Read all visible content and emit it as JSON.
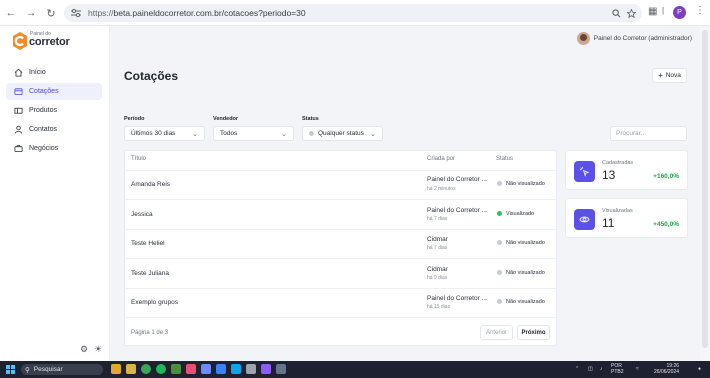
{
  "browser": {
    "url_protocol": "https://",
    "url_rest": "beta.paineldocorretor.com.br/cotacoes?periodo=30",
    "profile_letter": "P"
  },
  "logo": {
    "small": "Painel do",
    "big": "corretor"
  },
  "sidebar": {
    "items": [
      {
        "label": "Início",
        "icon": "home-icon"
      },
      {
        "label": "Cotações",
        "icon": "document-icon",
        "active": true
      },
      {
        "label": "Produtos",
        "icon": "box-icon"
      },
      {
        "label": "Contatos",
        "icon": "user-icon"
      },
      {
        "label": "Negócios",
        "icon": "briefcase-icon"
      }
    ]
  },
  "header": {
    "user": "Painel do Corretor (administrador)"
  },
  "page": {
    "title": "Cotações",
    "new_label": "Nova"
  },
  "filters": {
    "period_label": "Período",
    "period_value": "Últimos 30 dias",
    "seller_label": "Vendedor",
    "seller_value": "Todos",
    "status_label": "Status",
    "status_value": "Qualquer status",
    "search_placeholder": "Procurar..."
  },
  "table": {
    "headers": [
      "Título",
      "Criada por",
      "Status"
    ],
    "rows": [
      {
        "title": "Amanda Reis",
        "creator": "Painel do Corretor ...",
        "time": "há 2 minutos",
        "status": "Não visualizado"
      },
      {
        "title": "Jessica",
        "creator": "Painel do Corretor ...",
        "time": "há 7 dias",
        "status": "Visualizado"
      },
      {
        "title": "Teste Heliel",
        "creator": "Cidmar",
        "time": "há 7 dias",
        "status": "Não visualizado"
      },
      {
        "title": "Teste Juliana",
        "creator": "Cidmar",
        "time": "há 9 dias",
        "status": "Não visualizado"
      },
      {
        "title": "Exemplo grupos",
        "creator": "Painel do Corretor ...",
        "time": "há 15 dias",
        "status": "Não visualizado"
      }
    ],
    "pagination": "Página 1 de 3",
    "prev_label": "Anterior",
    "next_label": "Próximo"
  },
  "stats": [
    {
      "label": "Cadastradas",
      "value": "13",
      "delta": "+160,0%"
    },
    {
      "label": "Visualizadas",
      "value": "11",
      "delta": "+450,0%"
    }
  ],
  "taskbar": {
    "search": "Pesquisar",
    "lang_top": "POR",
    "lang_bottom": "PTB2",
    "time": "19:26",
    "date": "26/06/2024"
  },
  "colors": {
    "accent": "#5b51e6",
    "positive": "#16a34a",
    "viewed": "#22c55e"
  }
}
